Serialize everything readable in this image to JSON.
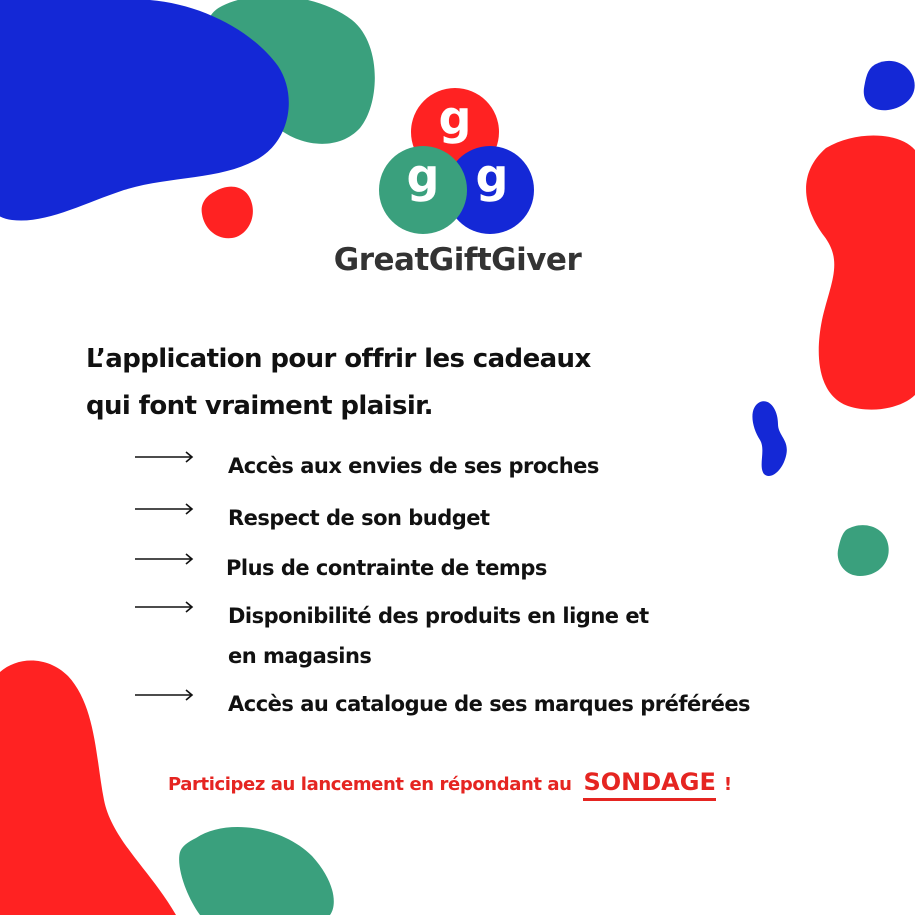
{
  "colors": {
    "blue": "#1428d6",
    "green": "#3aa07d",
    "red": "#ff2222",
    "text": "#111111",
    "brand_text": "#333333",
    "accent_red": "#e52521"
  },
  "logo": {
    "circles": [
      {
        "color": "red",
        "letter": "g"
      },
      {
        "color": "green",
        "letter": "g"
      },
      {
        "color": "blue",
        "letter": "g"
      }
    ]
  },
  "brand": {
    "name": "GreatGiftGiver"
  },
  "headline": {
    "line1": "L’application pour offrir les cadeaux",
    "line2": "qui font vraiment plaisir."
  },
  "features": [
    {
      "icon": "long-arrow-right-icon",
      "text_lines": [
        "Accès aux envies de ses proches"
      ]
    },
    {
      "icon": "long-arrow-right-icon",
      "text_lines": [
        "Respect de son budget"
      ]
    },
    {
      "icon": "long-arrow-right-icon",
      "text_lines": [
        "Plus de contrainte de temps"
      ]
    },
    {
      "icon": "long-arrow-right-icon",
      "text_lines": [
        "Disponibilité des produits en ligne et",
        "en magasins"
      ]
    },
    {
      "icon": "long-arrow-right-icon",
      "text_lines": [
        "Accès au catalogue de ses marques préférées"
      ]
    }
  ],
  "cta": {
    "lead": "Participez au lancement en répondant au",
    "link": "SONDAGE",
    "tail": "!"
  }
}
